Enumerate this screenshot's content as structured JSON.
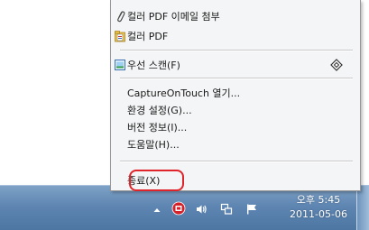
{
  "context_menu": {
    "items": [
      {
        "label": "컬러 PDF 이메일 첨부",
        "icon": "paperclip-icon"
      },
      {
        "label": "컬러 PDF",
        "icon": "pdf-file-icon"
      },
      {
        "label": "우선 스캔(F)",
        "icon": "scan-document-icon"
      },
      {
        "label": "CaptureOnTouch 열기..."
      },
      {
        "label": "환경 설정(G)..."
      },
      {
        "label": "버전 정보(I)..."
      },
      {
        "label": "도움말(H)..."
      },
      {
        "label": "종료(X)"
      }
    ]
  },
  "tray": {
    "clock_time": "오후 5:45",
    "clock_date": "2011-05-06",
    "icons": [
      "show-hidden-icons-chevron-icon",
      "captureontouch-icon",
      "volume-icon",
      "network-icon",
      "action-center-flag-icon"
    ]
  },
  "colors": {
    "highlight_border": "#e0242b",
    "taskbar": "#5f86b2",
    "menu_background": "#f4f5f6"
  }
}
